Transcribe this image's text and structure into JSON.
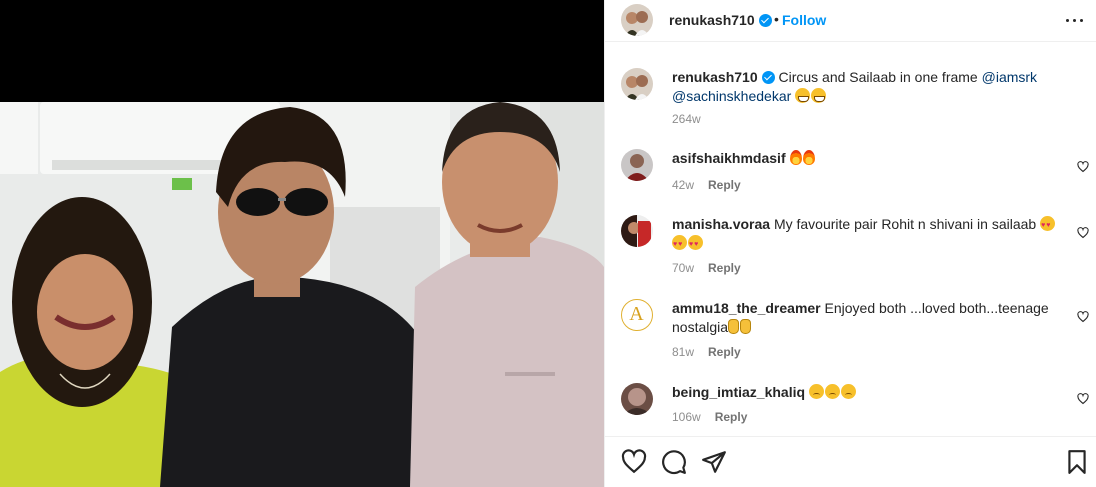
{
  "post": {
    "username": "renukash710",
    "follow_label": "Follow",
    "separator": "•"
  },
  "caption": {
    "username": "renukash710",
    "text": "Circus and Sailaab in one frame",
    "mentions": [
      "@iamsrk",
      "@sachinskhedekar"
    ],
    "emojis": [
      "grinning-squint-emoji",
      "grinning-squint-emoji"
    ],
    "time": "264w"
  },
  "comments": [
    {
      "username": "asifshaikhmdasif",
      "text": "",
      "emojis": [
        "fire-emoji",
        "fire-emoji"
      ],
      "time": "42w",
      "reply_label": "Reply"
    },
    {
      "username": "manisha.voraa",
      "text": "My favourite pair Rohit n shivani in sailaab",
      "emojis": [
        "heart-eyes-emoji",
        "heart-eyes-emoji",
        "heart-eyes-emoji"
      ],
      "time": "70w",
      "reply_label": "Reply"
    },
    {
      "username": "ammu18_the_dreamer",
      "text": "Enjoyed both ...loved both...teenage nostalgia",
      "emojis": [
        "victory-hand-emoji",
        "victory-hand-emoji"
      ],
      "time": "81w",
      "reply_label": "Reply"
    },
    {
      "username": "being_imtiaz_khaliq",
      "text": "",
      "emojis": [
        "sad-face-emoji",
        "sad-face-emoji",
        "sad-face-emoji"
      ],
      "time": "106w",
      "reply_label": "Reply"
    }
  ],
  "ammu_avatar_letter": "A",
  "colors": {
    "accent": "#0095f6",
    "mention": "#00376b",
    "muted": "#8e8e8e",
    "text": "#262626",
    "border": "#efefef"
  },
  "icons": [
    "heart-icon",
    "comment-icon",
    "share-icon",
    "bookmark-icon",
    "more-options-icon",
    "verified-badge-icon"
  ]
}
